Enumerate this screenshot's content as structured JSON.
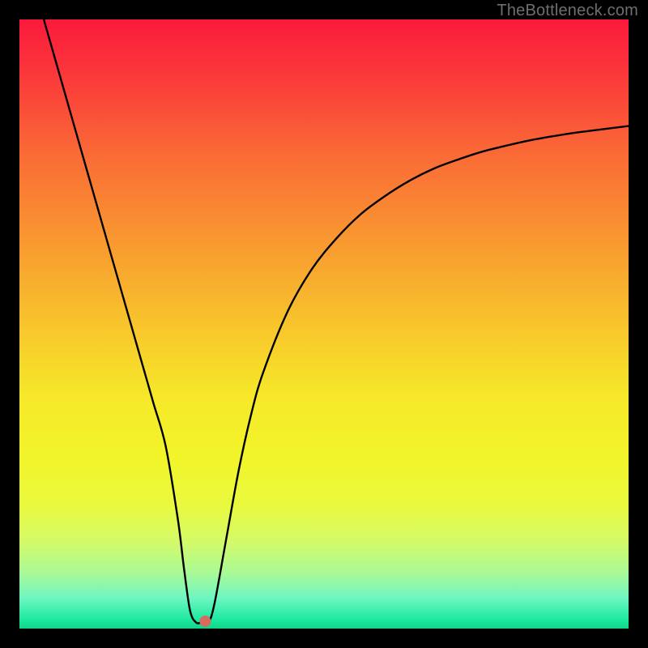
{
  "watermark": "TheBottleneck.com",
  "chart_data": {
    "type": "line",
    "title": "",
    "xlabel": "",
    "ylabel": "",
    "xlim": [
      0,
      100
    ],
    "ylim": [
      0,
      100
    ],
    "series": [
      {
        "name": "curve",
        "x": [
          4,
          6,
          8,
          10,
          12,
          14,
          16,
          18,
          20,
          22,
          24,
          26,
          27,
          28,
          29,
          30,
          31,
          32,
          34,
          36,
          38,
          40,
          44,
          48,
          52,
          56,
          60,
          64,
          68,
          72,
          76,
          80,
          84,
          88,
          92,
          96,
          100
        ],
        "y": [
          100,
          93,
          86,
          79,
          72,
          65,
          58,
          51,
          44,
          37,
          30,
          18,
          10,
          3,
          1,
          1,
          1,
          4,
          15,
          26,
          35,
          42,
          52,
          59,
          64,
          68,
          71,
          73.5,
          75.5,
          77,
          78.3,
          79.3,
          80.2,
          80.9,
          81.5,
          82,
          82.5
        ]
      }
    ],
    "marker": {
      "x": 30.5,
      "y": 1.2,
      "color": "#d96a5e",
      "radius_px": 7
    },
    "gradient_stops": [
      {
        "offset": 0.0,
        "color": "#fb1a3c"
      },
      {
        "offset": 0.1,
        "color": "#fb3b3a"
      },
      {
        "offset": 0.22,
        "color": "#fa6a36"
      },
      {
        "offset": 0.35,
        "color": "#f99431"
      },
      {
        "offset": 0.5,
        "color": "#f8c42c"
      },
      {
        "offset": 0.62,
        "color": "#f6e829"
      },
      {
        "offset": 0.72,
        "color": "#f2f52a"
      },
      {
        "offset": 0.8,
        "color": "#e9f93f"
      },
      {
        "offset": 0.86,
        "color": "#d2fa6a"
      },
      {
        "offset": 0.91,
        "color": "#a8f997"
      },
      {
        "offset": 0.95,
        "color": "#6ef6c2"
      },
      {
        "offset": 0.985,
        "color": "#1de9a0"
      },
      {
        "offset": 1.0,
        "color": "#0fd488"
      }
    ]
  }
}
